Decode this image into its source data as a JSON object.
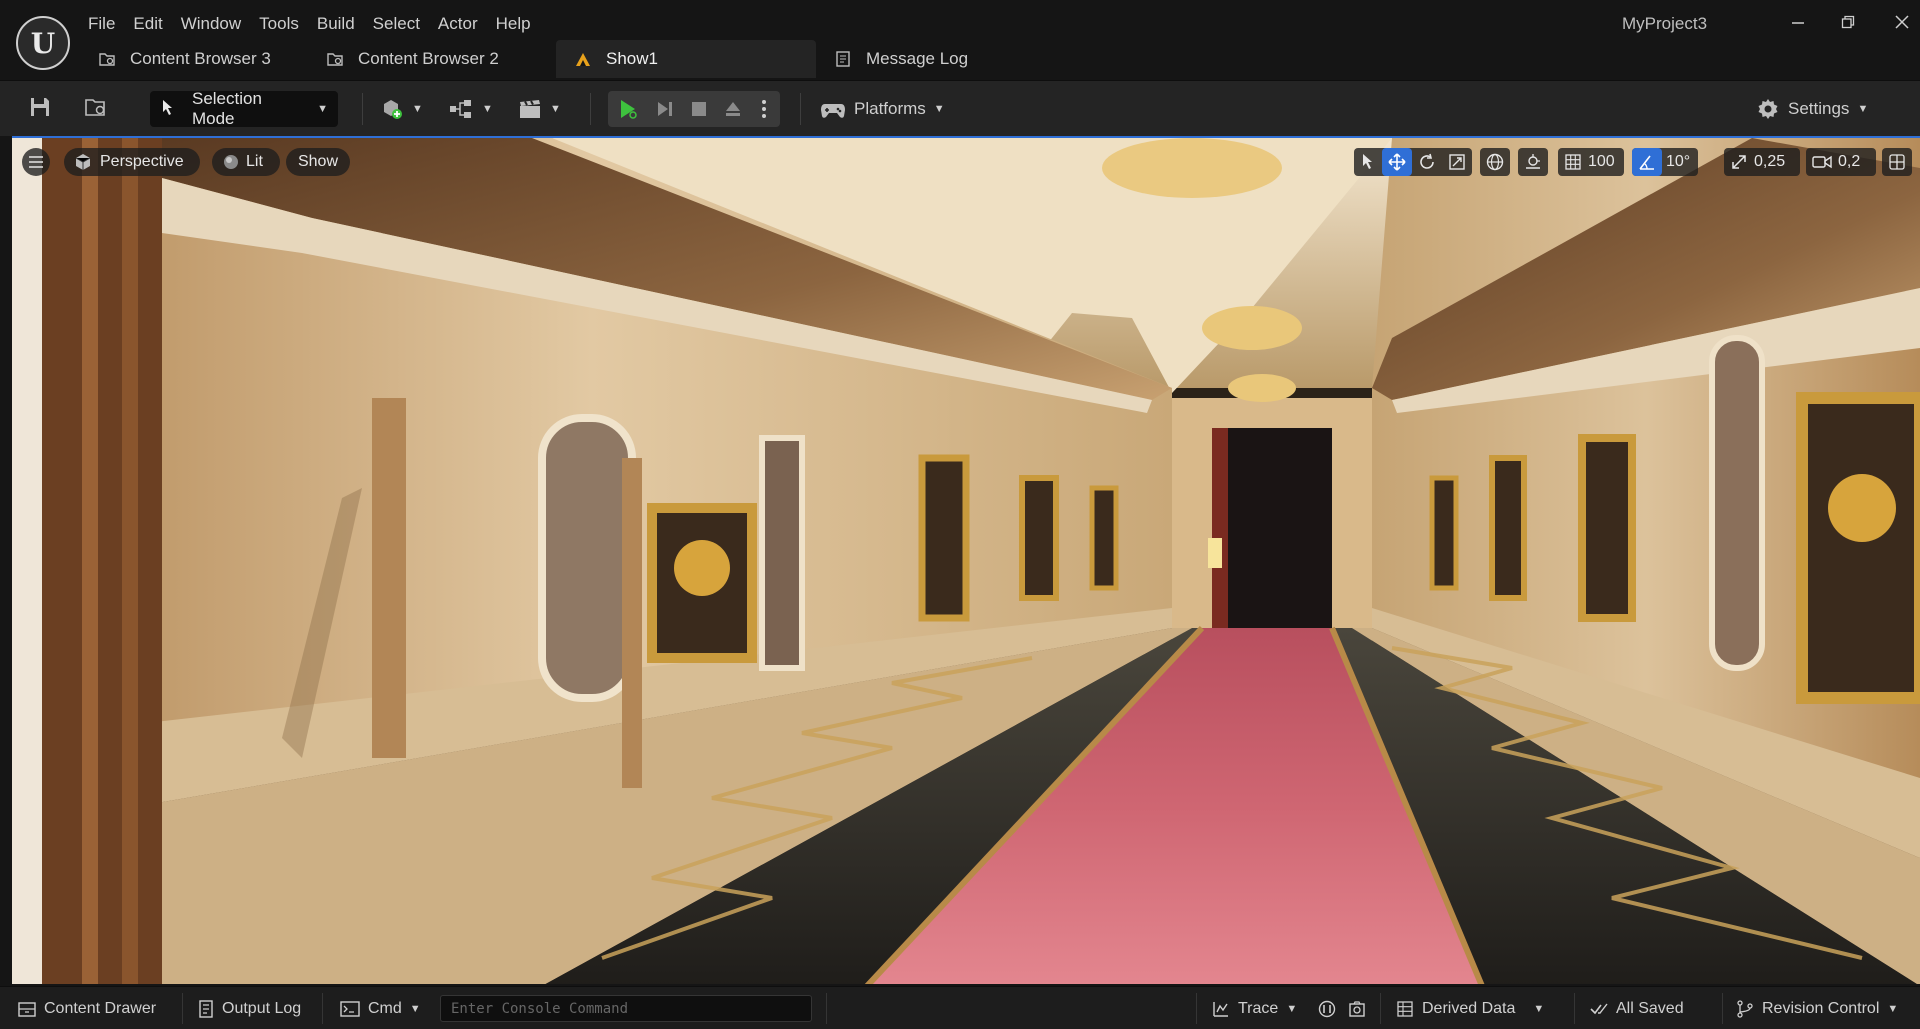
{
  "app": {
    "logo": "U",
    "project_name": "MyProject3"
  },
  "menu": [
    "File",
    "Edit",
    "Window",
    "Tools",
    "Build",
    "Select",
    "Actor",
    "Help"
  ],
  "tabs": [
    {
      "label": "Content Browser 3",
      "icon": "content-browser-icon"
    },
    {
      "label": "Content Browser 2",
      "icon": "content-browser-icon"
    },
    {
      "label": "Show1",
      "icon": "level-icon",
      "active": true
    },
    {
      "label": "Message Log",
      "icon": "message-log-icon"
    }
  ],
  "toolbar": {
    "selection_mode": "Selection Mode",
    "platforms": "Platforms",
    "settings": "Settings"
  },
  "viewport": {
    "perspective": "Perspective",
    "lit": "Lit",
    "show": "Show",
    "grid_snap": "100",
    "rotation_snap": "10°",
    "scale_snap": "0,25",
    "camera_speed": "0,2"
  },
  "statusbar": {
    "content_drawer": "Content Drawer",
    "output_log": "Output Log",
    "cmd": "Cmd",
    "console_placeholder": "Enter Console Command",
    "trace": "Trace",
    "derived_data": "Derived Data",
    "all_saved": "All Saved",
    "revision_control": "Revision Control"
  },
  "colors": {
    "accent": "#2f6fd6",
    "play_green": "#3ec23e",
    "carpet": "#d8707a"
  }
}
